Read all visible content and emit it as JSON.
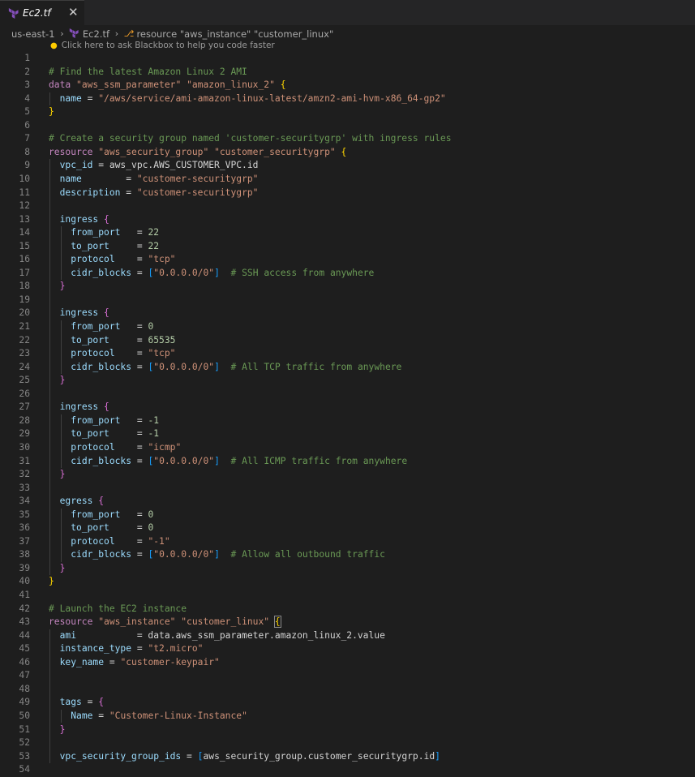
{
  "tab": {
    "filename": "Ec2.tf",
    "close_glyph": "✕",
    "icon": "terraform-icon",
    "icon_color": "#844fba"
  },
  "breadcrumb": {
    "region": "us-east-1",
    "file": "Ec2.tf",
    "symbol": "resource \"aws_instance\" \"customer_linux\""
  },
  "hint": {
    "text": "Click here to ask Blackbox to help you code faster",
    "icon": "lightbulb-icon"
  },
  "colors": {
    "background": "#1e1e1e",
    "comment": "#6a9955",
    "keyword": "#c586c0",
    "string": "#ce9178",
    "property": "#9cdcfe",
    "number": "#b5cea8",
    "line_number": "#858585"
  },
  "lines": [
    {
      "n": "1",
      "t": []
    },
    {
      "n": "2",
      "t": [
        [
          "c",
          "# Find the latest Amazon Linux 2 AMI"
        ]
      ]
    },
    {
      "n": "3",
      "t": [
        [
          "k",
          "data "
        ],
        [
          "s",
          "\"aws_ssm_parameter\""
        ],
        [
          "d",
          " "
        ],
        [
          "s",
          "\"amazon_linux_2\""
        ],
        [
          "d",
          " "
        ],
        [
          "y",
          "{"
        ]
      ]
    },
    {
      "n": "4",
      "t": [
        [
          "d",
          "  "
        ],
        [
          "p",
          "name"
        ],
        [
          "d",
          " = "
        ],
        [
          "s",
          "\"/aws/service/ami-amazon-linux-latest/amzn2-ami-hvm-x86_64-gp2\""
        ]
      ]
    },
    {
      "n": "5",
      "t": [
        [
          "y",
          "}"
        ]
      ]
    },
    {
      "n": "6",
      "t": []
    },
    {
      "n": "7",
      "t": [
        [
          "c",
          "# Create a security group named 'customer-securitygrp' with ingress rules"
        ]
      ]
    },
    {
      "n": "8",
      "t": [
        [
          "k",
          "resource "
        ],
        [
          "s",
          "\"aws_security_group\""
        ],
        [
          "d",
          " "
        ],
        [
          "s",
          "\"customer_securitygrp\""
        ],
        [
          "d",
          " "
        ],
        [
          "y",
          "{"
        ]
      ]
    },
    {
      "n": "9",
      "t": [
        [
          "d",
          "  "
        ],
        [
          "p",
          "vpc_id"
        ],
        [
          "d",
          " = aws_vpc.AWS_CUSTOMER_VPC.id"
        ]
      ]
    },
    {
      "n": "10",
      "t": [
        [
          "d",
          "  "
        ],
        [
          "p",
          "name"
        ],
        [
          "d",
          "        = "
        ],
        [
          "s",
          "\"customer-securitygrp\""
        ]
      ]
    },
    {
      "n": "11",
      "t": [
        [
          "d",
          "  "
        ],
        [
          "p",
          "description"
        ],
        [
          "d",
          " = "
        ],
        [
          "s",
          "\"customer-securitygrp\""
        ]
      ]
    },
    {
      "n": "12",
      "t": []
    },
    {
      "n": "13",
      "t": [
        [
          "d",
          "  "
        ],
        [
          "p",
          "ingress"
        ],
        [
          "d",
          " "
        ],
        [
          "m",
          "{"
        ]
      ]
    },
    {
      "n": "14",
      "t": [
        [
          "d",
          "    "
        ],
        [
          "p",
          "from_port"
        ],
        [
          "d",
          "   = "
        ],
        [
          "n",
          "22"
        ]
      ]
    },
    {
      "n": "15",
      "t": [
        [
          "d",
          "    "
        ],
        [
          "p",
          "to_port"
        ],
        [
          "d",
          "     = "
        ],
        [
          "n",
          "22"
        ]
      ]
    },
    {
      "n": "16",
      "t": [
        [
          "d",
          "    "
        ],
        [
          "p",
          "protocol"
        ],
        [
          "d",
          "    = "
        ],
        [
          "s",
          "\"tcp\""
        ]
      ]
    },
    {
      "n": "17",
      "t": [
        [
          "d",
          "    "
        ],
        [
          "p",
          "cidr_blocks"
        ],
        [
          "d",
          " = "
        ],
        [
          "b",
          "["
        ],
        [
          "s",
          "\"0.0.0.0/0\""
        ],
        [
          "b",
          "]"
        ],
        [
          "d",
          "  "
        ],
        [
          "c",
          "# SSH access from anywhere"
        ]
      ]
    },
    {
      "n": "18",
      "t": [
        [
          "d",
          "  "
        ],
        [
          "m",
          "}"
        ]
      ]
    },
    {
      "n": "19",
      "t": []
    },
    {
      "n": "20",
      "t": [
        [
          "d",
          "  "
        ],
        [
          "p",
          "ingress"
        ],
        [
          "d",
          " "
        ],
        [
          "m",
          "{"
        ]
      ]
    },
    {
      "n": "21",
      "t": [
        [
          "d",
          "    "
        ],
        [
          "p",
          "from_port"
        ],
        [
          "d",
          "   = "
        ],
        [
          "n",
          "0"
        ]
      ]
    },
    {
      "n": "22",
      "t": [
        [
          "d",
          "    "
        ],
        [
          "p",
          "to_port"
        ],
        [
          "d",
          "     = "
        ],
        [
          "n",
          "65535"
        ]
      ]
    },
    {
      "n": "23",
      "t": [
        [
          "d",
          "    "
        ],
        [
          "p",
          "protocol"
        ],
        [
          "d",
          "    = "
        ],
        [
          "s",
          "\"tcp\""
        ]
      ]
    },
    {
      "n": "24",
      "t": [
        [
          "d",
          "    "
        ],
        [
          "p",
          "cidr_blocks"
        ],
        [
          "d",
          " = "
        ],
        [
          "b",
          "["
        ],
        [
          "s",
          "\"0.0.0.0/0\""
        ],
        [
          "b",
          "]"
        ],
        [
          "d",
          "  "
        ],
        [
          "c",
          "# All TCP traffic from anywhere"
        ]
      ]
    },
    {
      "n": "25",
      "t": [
        [
          "d",
          "  "
        ],
        [
          "m",
          "}"
        ]
      ]
    },
    {
      "n": "26",
      "t": []
    },
    {
      "n": "27",
      "t": [
        [
          "d",
          "  "
        ],
        [
          "p",
          "ingress"
        ],
        [
          "d",
          " "
        ],
        [
          "m",
          "{"
        ]
      ]
    },
    {
      "n": "28",
      "t": [
        [
          "d",
          "    "
        ],
        [
          "p",
          "from_port"
        ],
        [
          "d",
          "   = "
        ],
        [
          "n",
          "-1"
        ]
      ]
    },
    {
      "n": "29",
      "t": [
        [
          "d",
          "    "
        ],
        [
          "p",
          "to_port"
        ],
        [
          "d",
          "     = "
        ],
        [
          "n",
          "-1"
        ]
      ]
    },
    {
      "n": "30",
      "t": [
        [
          "d",
          "    "
        ],
        [
          "p",
          "protocol"
        ],
        [
          "d",
          "    = "
        ],
        [
          "s",
          "\"icmp\""
        ]
      ]
    },
    {
      "n": "31",
      "t": [
        [
          "d",
          "    "
        ],
        [
          "p",
          "cidr_blocks"
        ],
        [
          "d",
          " = "
        ],
        [
          "b",
          "["
        ],
        [
          "s",
          "\"0.0.0.0/0\""
        ],
        [
          "b",
          "]"
        ],
        [
          "d",
          "  "
        ],
        [
          "c",
          "# All ICMP traffic from anywhere"
        ]
      ]
    },
    {
      "n": "32",
      "t": [
        [
          "d",
          "  "
        ],
        [
          "m",
          "}"
        ]
      ]
    },
    {
      "n": "33",
      "t": []
    },
    {
      "n": "34",
      "t": [
        [
          "d",
          "  "
        ],
        [
          "p",
          "egress"
        ],
        [
          "d",
          " "
        ],
        [
          "m",
          "{"
        ]
      ]
    },
    {
      "n": "35",
      "t": [
        [
          "d",
          "    "
        ],
        [
          "p",
          "from_port"
        ],
        [
          "d",
          "   = "
        ],
        [
          "n",
          "0"
        ]
      ]
    },
    {
      "n": "36",
      "t": [
        [
          "d",
          "    "
        ],
        [
          "p",
          "to_port"
        ],
        [
          "d",
          "     = "
        ],
        [
          "n",
          "0"
        ]
      ]
    },
    {
      "n": "37",
      "t": [
        [
          "d",
          "    "
        ],
        [
          "p",
          "protocol"
        ],
        [
          "d",
          "    = "
        ],
        [
          "s",
          "\"-1\""
        ]
      ]
    },
    {
      "n": "38",
      "t": [
        [
          "d",
          "    "
        ],
        [
          "p",
          "cidr_blocks"
        ],
        [
          "d",
          " = "
        ],
        [
          "b",
          "["
        ],
        [
          "s",
          "\"0.0.0.0/0\""
        ],
        [
          "b",
          "]"
        ],
        [
          "d",
          "  "
        ],
        [
          "c",
          "# Allow all outbound traffic"
        ]
      ]
    },
    {
      "n": "39",
      "t": [
        [
          "d",
          "  "
        ],
        [
          "m",
          "}"
        ]
      ]
    },
    {
      "n": "40",
      "t": [
        [
          "y",
          "}"
        ]
      ]
    },
    {
      "n": "41",
      "t": []
    },
    {
      "n": "42",
      "t": [
        [
          "c",
          "# Launch the EC2 instance"
        ]
      ]
    },
    {
      "n": "43",
      "t": [
        [
          "k",
          "resource "
        ],
        [
          "s",
          "\"aws_instance\""
        ],
        [
          "d",
          " "
        ],
        [
          "s",
          "\"customer_linux\""
        ],
        [
          "d",
          " "
        ],
        [
          "y",
          "{"
        ]
      ]
    },
    {
      "n": "44",
      "t": [
        [
          "d",
          "  "
        ],
        [
          "p",
          "ami"
        ],
        [
          "d",
          "           = data.aws_ssm_parameter.amazon_linux_2.value"
        ]
      ]
    },
    {
      "n": "45",
      "t": [
        [
          "d",
          "  "
        ],
        [
          "p",
          "instance_type"
        ],
        [
          "d",
          " = "
        ],
        [
          "s",
          "\"t2.micro\""
        ]
      ]
    },
    {
      "n": "46",
      "t": [
        [
          "d",
          "  "
        ],
        [
          "p",
          "key_name"
        ],
        [
          "d",
          " = "
        ],
        [
          "s",
          "\"customer-keypair\""
        ]
      ]
    },
    {
      "n": "47",
      "t": []
    },
    {
      "n": "48",
      "t": []
    },
    {
      "n": "49",
      "t": [
        [
          "d",
          "  "
        ],
        [
          "p",
          "tags"
        ],
        [
          "d",
          " = "
        ],
        [
          "m",
          "{"
        ]
      ]
    },
    {
      "n": "50",
      "t": [
        [
          "d",
          "    "
        ],
        [
          "p",
          "Name"
        ],
        [
          "d",
          " = "
        ],
        [
          "s",
          "\"Customer-Linux-Instance\""
        ]
      ]
    },
    {
      "n": "51",
      "t": [
        [
          "d",
          "  "
        ],
        [
          "m",
          "}"
        ]
      ]
    },
    {
      "n": "52",
      "t": []
    },
    {
      "n": "53",
      "t": [
        [
          "d",
          "  "
        ],
        [
          "p",
          "vpc_security_group_ids"
        ],
        [
          "d",
          " = "
        ],
        [
          "b",
          "["
        ],
        [
          "d",
          "aws_security_group.customer_securitygrp.id"
        ],
        [
          "b",
          "]"
        ]
      ]
    },
    {
      "n": "54",
      "t": []
    }
  ]
}
